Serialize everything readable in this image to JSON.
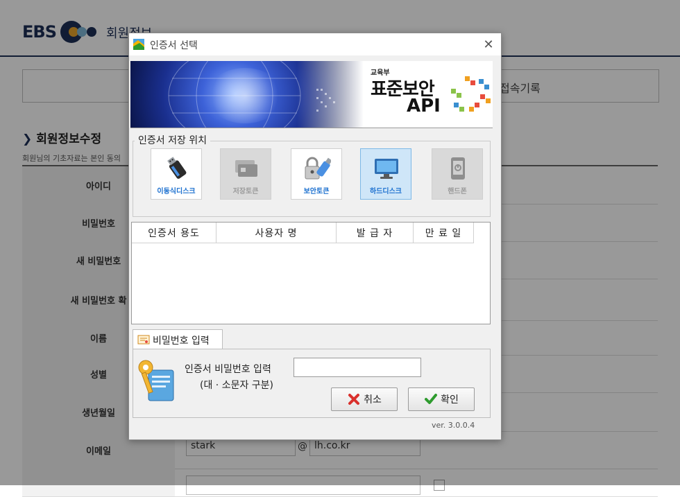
{
  "background_page": {
    "logo_text": "EBS",
    "page_title": "회원정보",
    "tab_right_label": "접속기록",
    "section_title": "회원정보수정",
    "section_desc": "회원님의 기초자료는 본인 동의",
    "form_rows": [
      {
        "label": "아이디"
      },
      {
        "label": "비밀번호"
      },
      {
        "label": "새 비밀번호"
      },
      {
        "label": "새 비밀번호 확"
      },
      {
        "label": "이름"
      },
      {
        "label": "성별"
      },
      {
        "label": "생년월일"
      },
      {
        "label": "이메일"
      }
    ],
    "email_id": "stark",
    "email_at": "@",
    "email_domain": "lh.co.kr",
    "phone_value": "",
    "agree_text": ""
  },
  "dialog": {
    "title": "인증서 선택",
    "close_glyph": "✕",
    "banner": {
      "ministry": "교육부",
      "product": "표준보안",
      "api": "API"
    },
    "storage_legend": "인증서 저장 위치",
    "storage_options": [
      {
        "label": "이동식디스크",
        "state": "normal"
      },
      {
        "label": "저장토큰",
        "state": "disabled"
      },
      {
        "label": "보안토큰",
        "state": "normal"
      },
      {
        "label": "하드디스크",
        "state": "selected"
      },
      {
        "label": "핸드폰",
        "state": "disabled"
      }
    ],
    "table_headers": [
      "인증서 용도",
      "사용자 명",
      "발 급 자",
      "만 료 일"
    ],
    "password_tab": "비밀번호 입력",
    "password_label": "인증서 비밀번호 입력",
    "password_hint": "(대 · 소문자 구분)",
    "password_value": "",
    "cancel_label": "취소",
    "ok_label": "확인",
    "version": "ver. 3.0.0.4"
  },
  "colors": {
    "brand_navy": "#1d2f57",
    "selected_bg": "#cfe6f8",
    "cancel_red": "#d9302c",
    "ok_green": "#2e9b2e"
  }
}
